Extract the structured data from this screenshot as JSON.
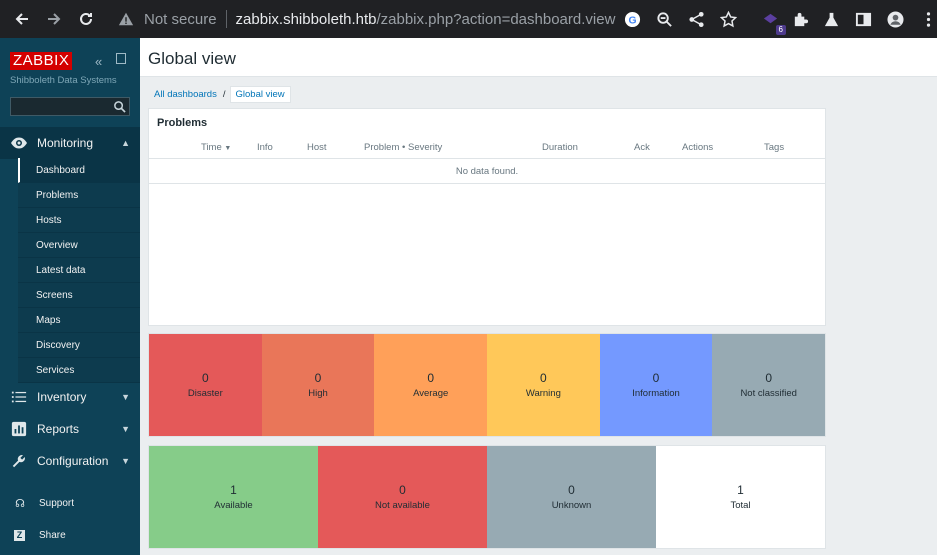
{
  "browser": {
    "not_secure": "Not secure",
    "url_host": "zabbix.shibboleth.htb",
    "url_path": "/zabbix.php?action=dashboard.view",
    "extension_badge": "6"
  },
  "sidebar": {
    "logo": "ZABBIX",
    "org": "Shibboleth Data Systems",
    "search_placeholder": "",
    "monitoring": {
      "label": "Monitoring",
      "items": [
        "Dashboard",
        "Problems",
        "Hosts",
        "Overview",
        "Latest data",
        "Screens",
        "Maps",
        "Discovery",
        "Services"
      ]
    },
    "sections": [
      {
        "label": "Inventory",
        "icon": "list-icon"
      },
      {
        "label": "Reports",
        "icon": "bar-chart-icon"
      },
      {
        "label": "Configuration",
        "icon": "wrench-icon"
      }
    ],
    "footer": [
      {
        "label": "Support",
        "icon": "support-icon"
      },
      {
        "label": "Share",
        "icon": "share-z-icon"
      }
    ]
  },
  "page": {
    "title": "Global view",
    "breadcrumb": {
      "parent": "All dashboards",
      "sep": "/",
      "current": "Global view"
    }
  },
  "problems": {
    "title": "Problems",
    "columns": [
      "Time",
      "Info",
      "Host",
      "Problem • Severity",
      "Duration",
      "Ack",
      "Actions",
      "Tags"
    ],
    "empty": "No data found."
  },
  "severity": [
    {
      "count": "0",
      "label": "Disaster",
      "color": "#e45959"
    },
    {
      "count": "0",
      "label": "High",
      "color": "#e97659"
    },
    {
      "count": "0",
      "label": "Average",
      "color": "#ffa059"
    },
    {
      "count": "0",
      "label": "Warning",
      "color": "#ffc859"
    },
    {
      "count": "0",
      "label": "Information",
      "color": "#7499ff"
    },
    {
      "count": "0",
      "label": "Not classified",
      "color": "#97aab3"
    }
  ],
  "host_availability": [
    {
      "count": "1",
      "label": "Available",
      "color": "#86cc89"
    },
    {
      "count": "0",
      "label": "Not available",
      "color": "#e45959"
    },
    {
      "count": "0",
      "label": "Unknown",
      "color": "#97aab3"
    },
    {
      "count": "1",
      "label": "Total",
      "color": "#ffffff"
    }
  ]
}
